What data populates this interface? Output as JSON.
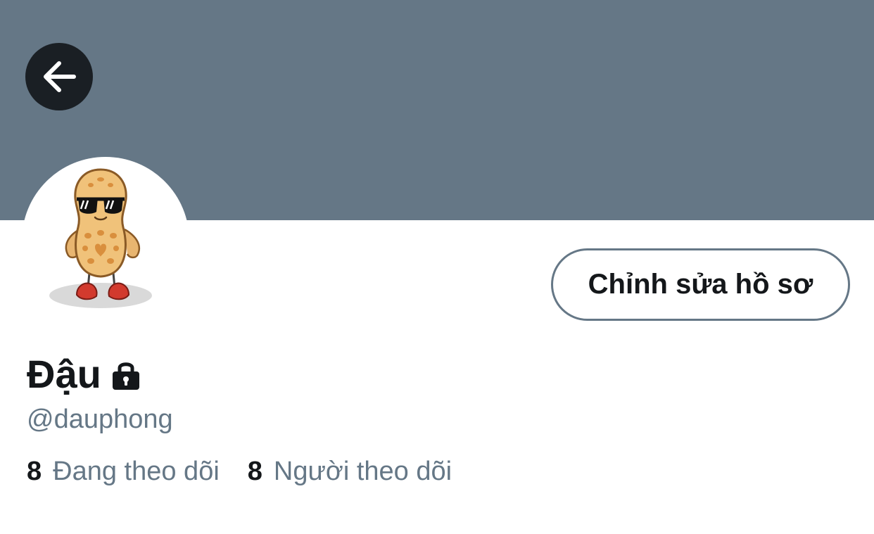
{
  "profile": {
    "display_name": "Đậu",
    "handle": "@dauphong",
    "edit_profile_label": "Chỉnh sửa hồ sơ",
    "protected": true
  },
  "stats": {
    "following_count": "8",
    "following_label": "Đang theo dõi",
    "followers_count": "8",
    "followers_label": "Người theo dõi"
  },
  "icons": {
    "back": "arrow-left-icon",
    "lock": "lock-icon"
  },
  "colors": {
    "banner": "#657786",
    "back_button_bg": "#1a1f24",
    "primary_text": "#14171a",
    "secondary_text": "#657786",
    "button_border": "#657786"
  }
}
